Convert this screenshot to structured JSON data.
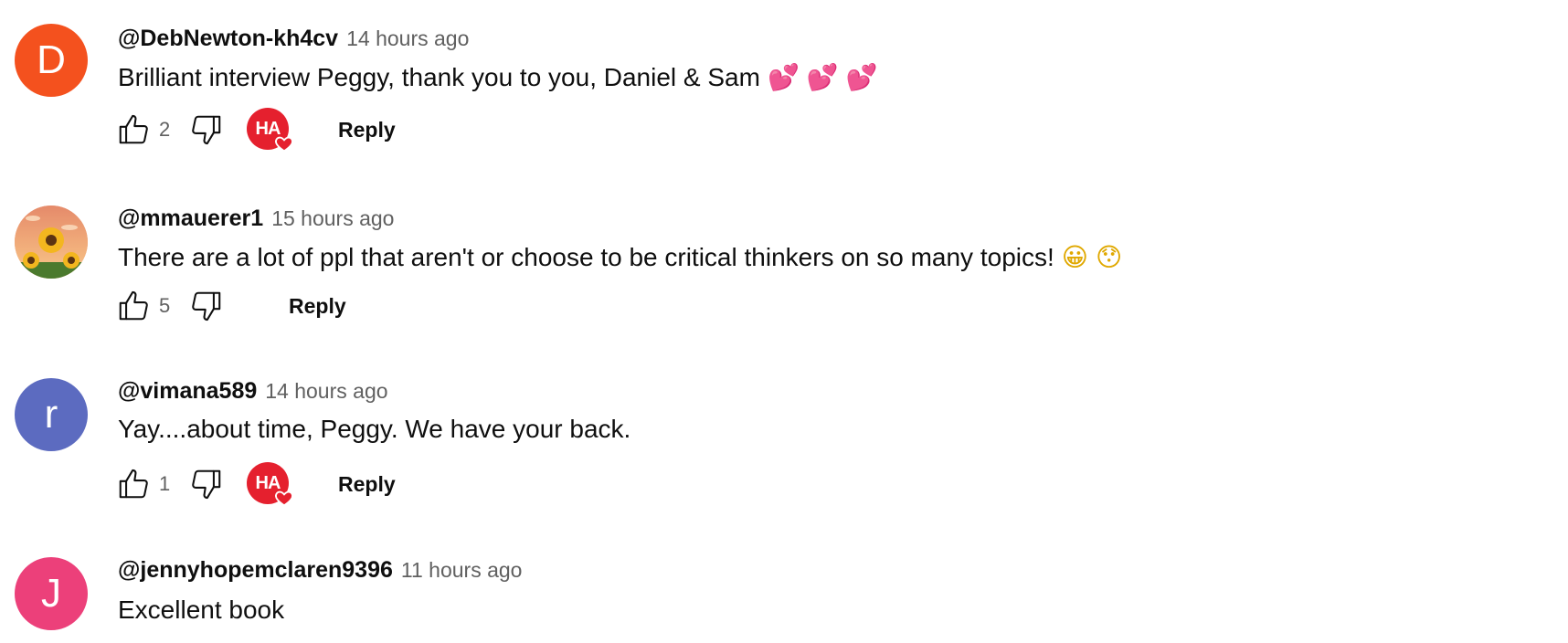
{
  "comments": [
    {
      "author": "@DebNewton-kh4cv",
      "time": "14 hours ago",
      "text": "Brilliant interview Peggy, thank you to you, Daniel & Sam",
      "emojis": [
        "💕",
        "💕",
        "💕"
      ],
      "avatar_letter": "D",
      "avatar_color": "#f4511e",
      "likes": "2",
      "hearted": true,
      "heart_badge_text": "HA",
      "reply_label": "Reply"
    },
    {
      "author": "@mmauerer1",
      "time": "15 hours ago",
      "text": "There are a lot of ppl that aren't or choose to be critical thinkers on so many topics!",
      "emojis": [
        "😀",
        "😯"
      ],
      "avatar_icon": "sunflower-avatar",
      "likes": "5",
      "hearted": false,
      "reply_label": "Reply"
    },
    {
      "author": "@vimana589",
      "time": "14 hours ago",
      "text": "Yay....about time, Peggy. We have your back.",
      "emojis": [],
      "avatar_letter": "r",
      "avatar_color": "#5c6bc0",
      "likes": "1",
      "hearted": true,
      "heart_badge_text": "HA",
      "reply_label": "Reply"
    },
    {
      "author": "@jennyhopemclaren9396",
      "time": "11 hours ago",
      "text": "Excellent book",
      "emojis": [],
      "avatar_letter": "J",
      "avatar_color": "#ec407a"
    }
  ],
  "colors": {
    "creator_heart_badge": "#e5202e",
    "secondary_text": "#606060"
  }
}
